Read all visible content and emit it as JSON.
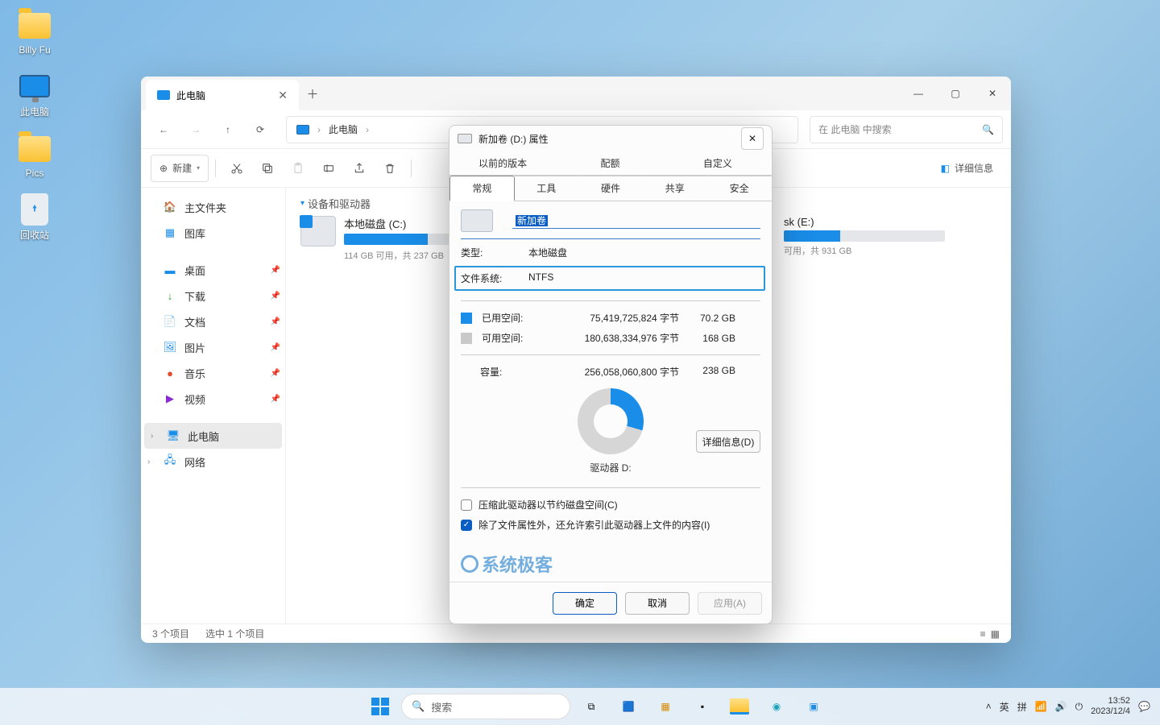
{
  "desktop": {
    "icons": [
      "Billy Fu",
      "此电脑",
      "Pics",
      "回收站"
    ]
  },
  "explorer": {
    "tab_title": "此电脑",
    "breadcrumb": "此电脑",
    "search_placeholder": "在 此电脑 中搜索",
    "new_button": "新建",
    "details_button": "详细信息",
    "nav": {
      "home": "主文件夹",
      "library": "图库",
      "desktop": "桌面",
      "downloads": "下载",
      "documents": "文档",
      "pictures": "图片",
      "music": "音乐",
      "videos": "视频",
      "thispc": "此电脑",
      "network": "网络"
    },
    "group": "设备和驱动器",
    "drives": {
      "c": {
        "name": "本地磁盘 (C:)",
        "sub": "114 GB 可用，共 237 GB",
        "fill": 52
      },
      "e": {
        "name": "sk (E:)",
        "sub": "可用，共 931 GB",
        "fill": 35
      }
    },
    "status": {
      "items": "3 个项目",
      "selected": "选中 1 个项目"
    }
  },
  "props": {
    "title": "新加卷 (D:) 属性",
    "tabs_top": [
      "以前的版本",
      "配额",
      "自定义"
    ],
    "tabs_bottom": [
      "常规",
      "工具",
      "硬件",
      "共享",
      "安全"
    ],
    "name_value": "新加卷",
    "type_label": "类型:",
    "type_value": "本地磁盘",
    "fs_label": "文件系统:",
    "fs_value": "NTFS",
    "used_label": "已用空间:",
    "used_bytes": "75,419,725,824 字节",
    "used_gb": "70.2 GB",
    "free_label": "可用空间:",
    "free_bytes": "180,638,334,976 字节",
    "free_gb": "168 GB",
    "cap_label": "容量:",
    "cap_bytes": "256,058,060,800 字节",
    "cap_gb": "238 GB",
    "drive_label": "驱动器 D:",
    "detail_btn": "详细信息(D)",
    "compress": "压缩此驱动器以节约磁盘空间(C)",
    "index": "除了文件属性外，还允许索引此驱动器上文件的内容(I)",
    "watermark": "系统极客",
    "ok": "确定",
    "cancel": "取消",
    "apply": "应用(A)"
  },
  "taskbar": {
    "search": "搜索",
    "ime1": "英",
    "ime2": "拼",
    "time": "13:52",
    "date": "2023/12/4"
  }
}
